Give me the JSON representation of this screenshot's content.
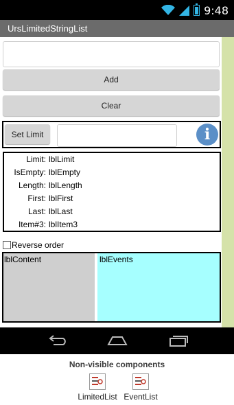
{
  "status_bar": {
    "time": "9:48"
  },
  "app": {
    "title": "UrsLimitedStringList"
  },
  "input": {
    "value": "",
    "placeholder": ""
  },
  "buttons": {
    "add": "Add",
    "clear": "Clear",
    "set_limit": "Set Limit"
  },
  "limit_input": {
    "value": ""
  },
  "info_icon": {
    "glyph": "i"
  },
  "table": {
    "rows": [
      {
        "label": "Limit:",
        "value": "lblLimit"
      },
      {
        "label": "IsEmpty:",
        "value": "lblEmpty"
      },
      {
        "label": "Length:",
        "value": "lblLength"
      },
      {
        "label": "First:",
        "value": "lblFirst"
      },
      {
        "label": "Last:",
        "value": "lblLast"
      },
      {
        "label": "Item#3:",
        "value": "lblItem3"
      }
    ]
  },
  "reverse": {
    "label": "Reverse order",
    "checked": false
  },
  "lists": {
    "content": "lblContent",
    "events": "lblEvents"
  },
  "non_visible": {
    "title": "Non-visible components",
    "items": [
      {
        "label": "LimitedList",
        "icon": "list-component-icon"
      },
      {
        "label": "EventList",
        "icon": "list-component-icon"
      }
    ]
  },
  "colors": {
    "frame": "#d5e2a9",
    "title_bar": "#6b6b6b",
    "events_bg": "#a6ffff",
    "content_bg": "#cfcfcf",
    "accent": "#33b5e5"
  }
}
